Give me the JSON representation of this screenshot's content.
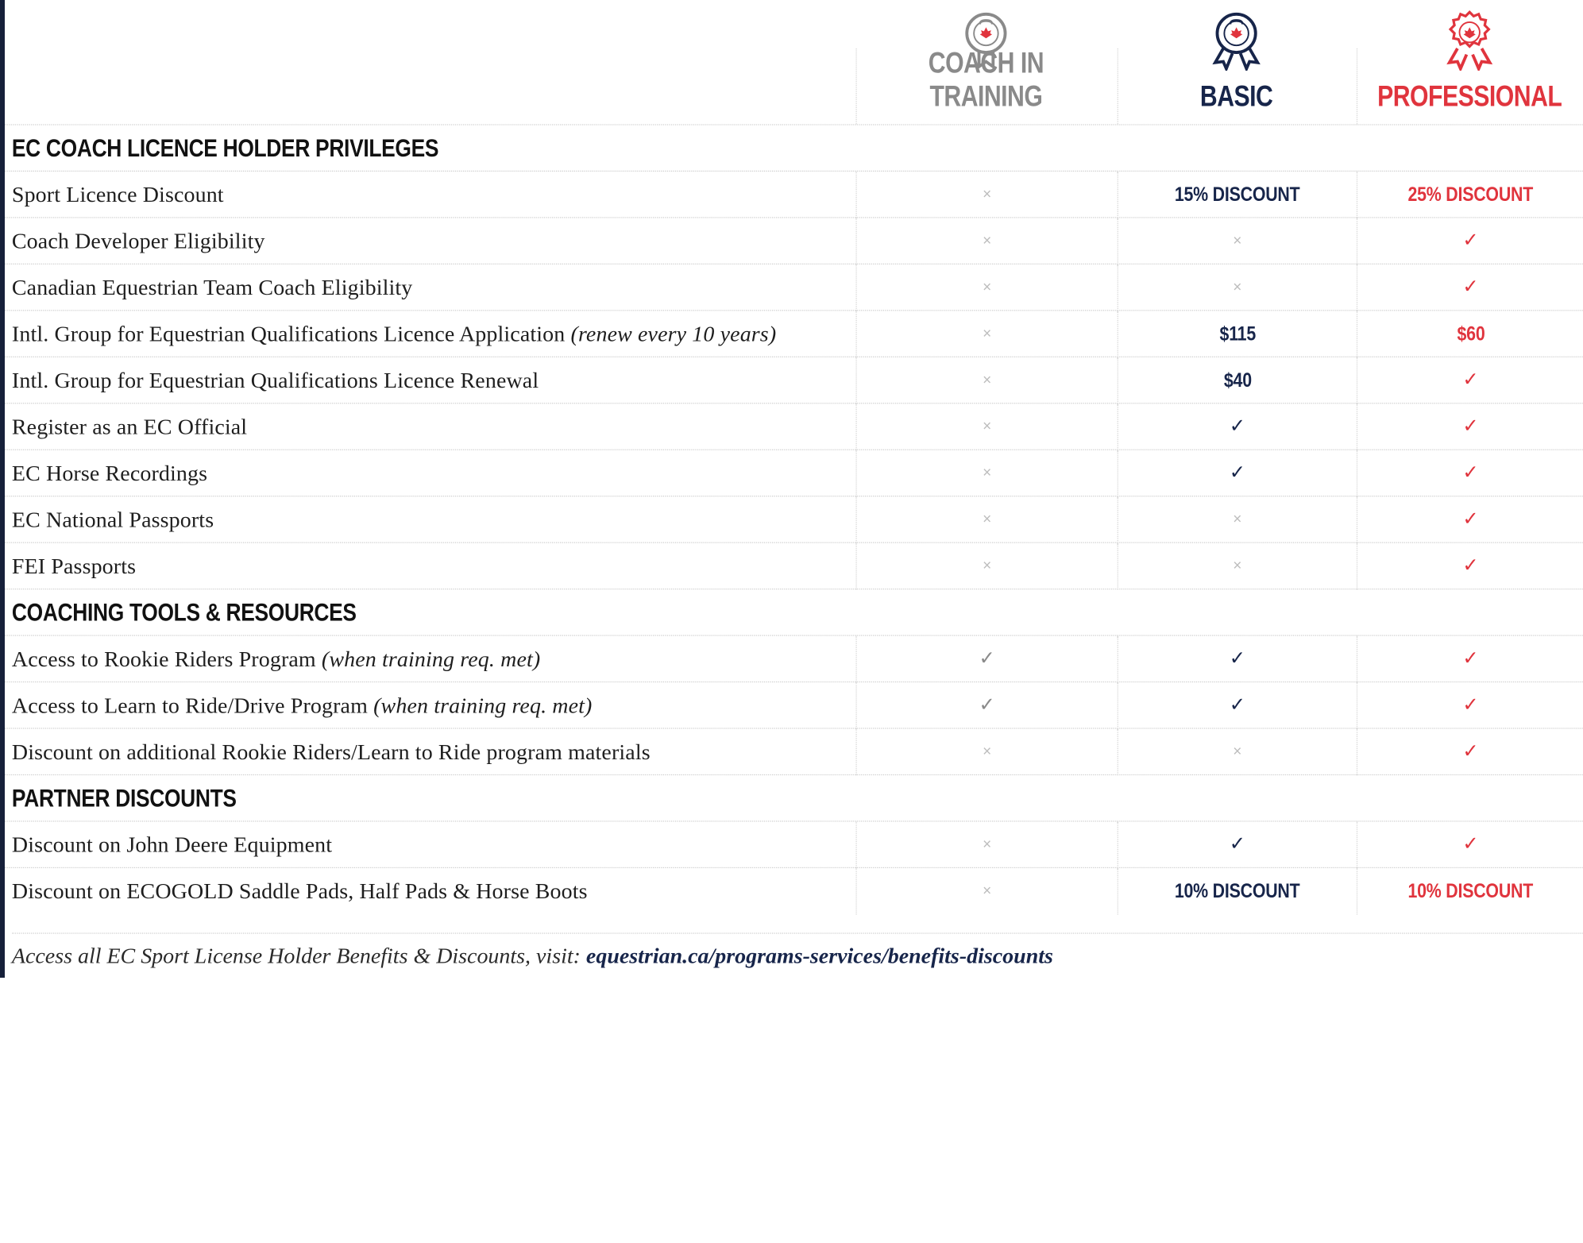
{
  "tiers": {
    "coach_in_training": {
      "name": "COACH IN TRAINING",
      "color": "#8a8a8a",
      "icon": "ribbon-badge-icon"
    },
    "basic": {
      "name": "BASIC",
      "color": "#17254a",
      "icon": "ribbon-badge-icon"
    },
    "professional": {
      "name": "PROFESSIONAL",
      "color": "#e0343d",
      "icon": "rosette-badge-icon"
    }
  },
  "sections": [
    {
      "title": "EC COACH LICENCE HOLDER PRIVILEGES",
      "rows": [
        {
          "label": "Sport Licence Discount",
          "note": "",
          "cit": "x",
          "basic": "15% DISCOUNT",
          "pro": "25% DISCOUNT"
        },
        {
          "label": "Coach Developer Eligibility",
          "note": "",
          "cit": "x",
          "basic": "x",
          "pro": "check"
        },
        {
          "label": "Canadian Equestrian Team Coach Eligibility",
          "note": "",
          "cit": "x",
          "basic": "x",
          "pro": "check"
        },
        {
          "label": "Intl. Group for Equestrian Qualifications Licence Application ",
          "note": "(renew every 10 years)",
          "cit": "x",
          "basic": "$115",
          "pro": "$60"
        },
        {
          "label": "Intl. Group for Equestrian Qualifications Licence Renewal",
          "note": "",
          "cit": "x",
          "basic": "$40",
          "pro": "check"
        },
        {
          "label": "Register as an EC Official",
          "note": "",
          "cit": "x",
          "basic": "check",
          "pro": "check"
        },
        {
          "label": "EC Horse Recordings",
          "note": "",
          "cit": "x",
          "basic": "check",
          "pro": "check"
        },
        {
          "label": "EC National Passports",
          "note": "",
          "cit": "x",
          "basic": "x",
          "pro": "check"
        },
        {
          "label": "FEI Passports",
          "note": "",
          "cit": "x",
          "basic": "x",
          "pro": "check"
        }
      ]
    },
    {
      "title": "COACHING TOOLS & RESOURCES",
      "rows": [
        {
          "label": "Access to Rookie Riders Program ",
          "note": "(when training req. met)",
          "cit": "check",
          "basic": "check",
          "pro": "check"
        },
        {
          "label": "Access to Learn to Ride/Drive Program ",
          "note": "(when training req. met)",
          "cit": "check",
          "basic": "check",
          "pro": "check"
        },
        {
          "label": "Discount on additional Rookie Riders/Learn to Ride program materials",
          "note": "",
          "cit": "x",
          "basic": "x",
          "pro": "check"
        }
      ]
    },
    {
      "title": "PARTNER DISCOUNTS",
      "rows": [
        {
          "label": "Discount on John Deere Equipment",
          "note": "",
          "cit": "x",
          "basic": "check",
          "pro": "check"
        },
        {
          "label": "Discount on ECOGOLD Saddle Pads, Half Pads & Horse Boots",
          "note": "",
          "cit": "x",
          "basic": "10% DISCOUNT",
          "pro": "10% DISCOUNT"
        }
      ]
    }
  ],
  "marks": {
    "x": "×",
    "check": "✓"
  },
  "footer": {
    "text": "Access all EC Sport License Holder Benefits & Discounts, visit: ",
    "link": "equestrian.ca/programs-services/benefits-discounts"
  }
}
